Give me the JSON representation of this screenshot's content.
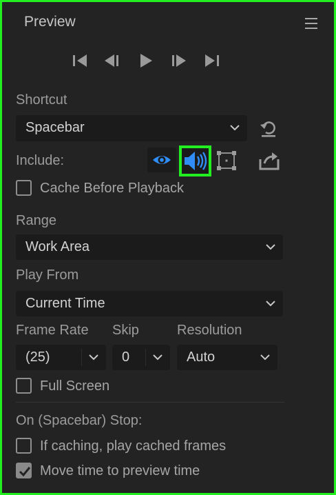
{
  "panel": {
    "title": "Preview"
  },
  "transport": {
    "icons": [
      "first-frame-icon",
      "previous-frame-icon",
      "play-icon",
      "next-frame-icon",
      "last-frame-icon"
    ]
  },
  "shortcut": {
    "label": "Shortcut",
    "value": "Spacebar"
  },
  "include": {
    "label": "Include:",
    "video_active": true,
    "audio_active": true,
    "overlays_active": false
  },
  "cache_before_playback": {
    "label": "Cache Before Playback",
    "checked": false
  },
  "range": {
    "label": "Range",
    "value": "Work Area"
  },
  "play_from": {
    "label": "Play From",
    "value": "Current Time"
  },
  "frame_rate": {
    "label": "Frame Rate",
    "value": "(25)"
  },
  "skip": {
    "label": "Skip",
    "value": "0"
  },
  "resolution": {
    "label": "Resolution",
    "value": "Auto"
  },
  "full_screen": {
    "label": "Full Screen",
    "checked": false
  },
  "on_stop": {
    "label": "On (Spacebar) Stop:",
    "if_caching": {
      "label": "If caching, play cached frames",
      "checked": false
    },
    "move_time": {
      "label": "Move time to preview time",
      "checked": true
    }
  },
  "colors": {
    "accent_blue": "#2f8df5",
    "highlight_green": "#22ee22",
    "panel_bg": "#232323",
    "field_bg": "#1b1b1b"
  }
}
